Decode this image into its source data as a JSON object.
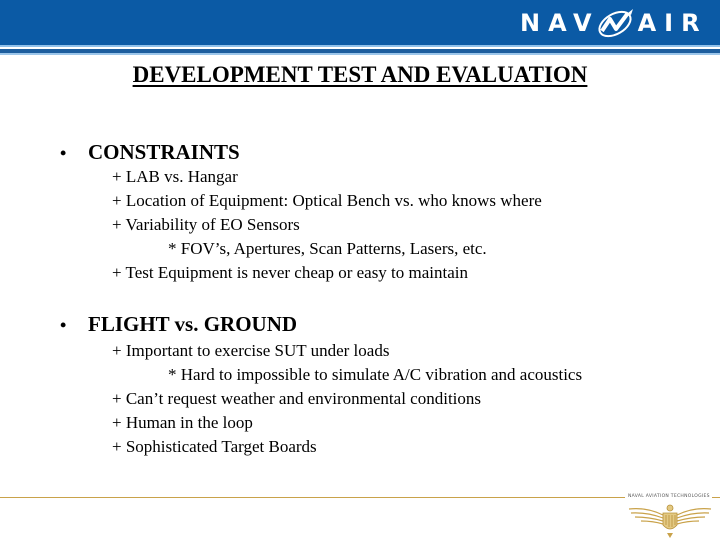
{
  "header": {
    "logo_text_left": "NAV",
    "logo_text_right": "AIR",
    "brand_color": "#0b5aa5"
  },
  "title": "DEVELOPMENT TEST AND EVALUATION",
  "sections": [
    {
      "bullet": "•",
      "heading": "CONSTRAINTS",
      "items": [
        {
          "text": "+ LAB vs. Hangar",
          "level": 1
        },
        {
          "text": "+ Location of Equipment: Optical Bench vs. who knows where",
          "level": 1
        },
        {
          "text": "+ Variability of EO Sensors",
          "level": 1
        },
        {
          "text": "* FOV’s, Apertures, Scan Patterns, Lasers, etc.",
          "level": 2
        },
        {
          "text": "+ Test Equipment is never cheap or easy to maintain",
          "level": 1
        }
      ]
    },
    {
      "bullet": "•",
      "heading": "FLIGHT vs. GROUND",
      "items": [
        {
          "text": "+ Important to exercise SUT under loads",
          "level": 1
        },
        {
          "text": "* Hard to impossible to simulate A/C vibration and acoustics",
          "level": 2
        },
        {
          "text": "+ Can’t request weather and environmental conditions",
          "level": 1
        },
        {
          "text": "+ Human in the loop",
          "level": 1
        },
        {
          "text": "+ Sophisticated Target Boards",
          "level": 1
        }
      ]
    }
  ],
  "footer": {
    "tagline": "NAVAL AVIATION TECHNOLOGIES",
    "accent_color": "#c9a24a"
  }
}
